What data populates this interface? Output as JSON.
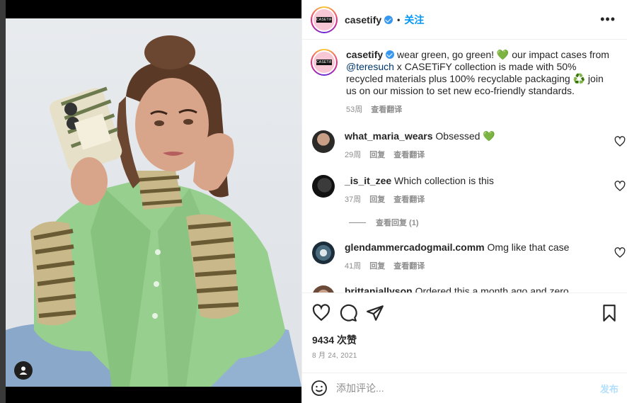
{
  "post": {
    "username": "casetify",
    "follow_label": "关注",
    "more_icon": "more-horizontal-icon",
    "avatar_logo_text": "CASETiFY"
  },
  "caption": {
    "username": "casetify",
    "text_1": " wear green, go green! ",
    "emoji_1": "💚",
    "text_2": " our impact cases from ",
    "mention": "@teresuch",
    "text_3": " x CASETiFY collection is made with 50% recycled materials plus 100% recyclable packaging ",
    "emoji_2": "♻️",
    "text_4": " join us on our mission to set new eco-friendly standards.",
    "age": "53周",
    "translate": "查看翻译"
  },
  "comments": [
    {
      "username": "what_maria_wears",
      "text": " Obsessed ",
      "emoji": "💚",
      "age": "29周",
      "reply": "回复",
      "translate": "查看翻译"
    },
    {
      "username": "_is_it_zee",
      "text": " Which collection is this",
      "age": "37周",
      "reply": "回复",
      "translate": "查看翻译",
      "view_replies": "查看回复 (1)"
    },
    {
      "username": "glendammercadogmail.comm",
      "text": " Omg like that case",
      "age": "41周",
      "reply": "回复",
      "translate": "查看翻译"
    },
    {
      "username": "brittaniallyson",
      "text": " Ordered this a month ago and zero updates"
    }
  ],
  "stats": {
    "likes": "9434 次赞",
    "date": "8 月 24, 2021"
  },
  "composer": {
    "placeholder": "添加评论...",
    "post_label": "发布"
  },
  "colors": {
    "link_blue": "#0095f6",
    "verified_blue": "#3897f0",
    "jacket_green": "#97cf8f",
    "muted_text": "#8e8e8e"
  }
}
